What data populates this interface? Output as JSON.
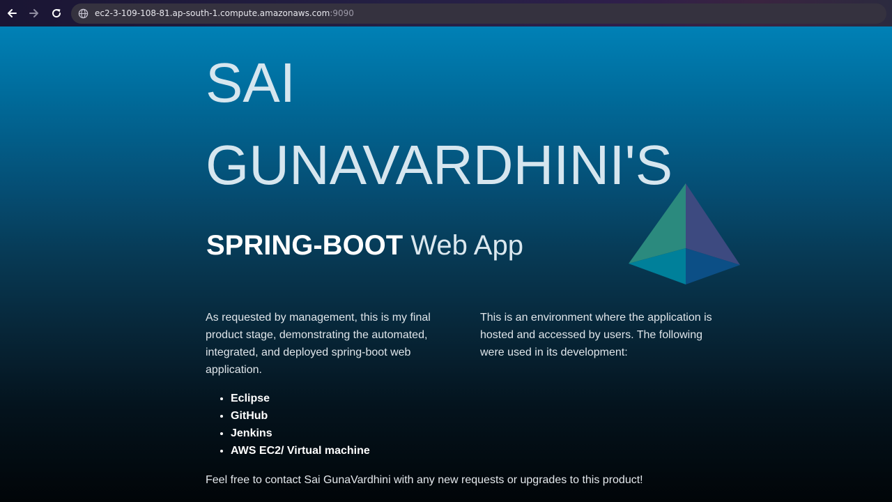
{
  "browser": {
    "url_host": "ec2-3-109-108-81.ap-south-1.compute.amazonaws.com",
    "url_port": ":9090",
    "icons": {
      "back": "arrow-left-icon",
      "forward": "arrow-right-icon",
      "reload": "reload-icon",
      "site_info": "globe-icon"
    }
  },
  "page": {
    "title": "SAI GUNAVARDHINI'S",
    "subtitle_strong": "SPRING-BOOT",
    "subtitle_rest": " Web App",
    "intro_left": "As requested by management, this is my final product stage, demonstrating the automated, integrated, and deployed spring-boot web application.",
    "intro_right": "This is an environment where the application is hosted and accessed by users. The following were used in its development:",
    "tools": [
      "Eclipse",
      "GitHub",
      "Jenkins",
      "AWS EC2/ Virtual machine"
    ],
    "contact": "Feel free to contact Sai GunaVardhini with any new requests or upgrades to this product!",
    "logo_icon": "pyramid-logo-icon"
  },
  "colors": {
    "page_top": "#0081b6",
    "page_bottom": "#010508",
    "text": "#dfe5ea",
    "address_bar": "#35323f"
  }
}
